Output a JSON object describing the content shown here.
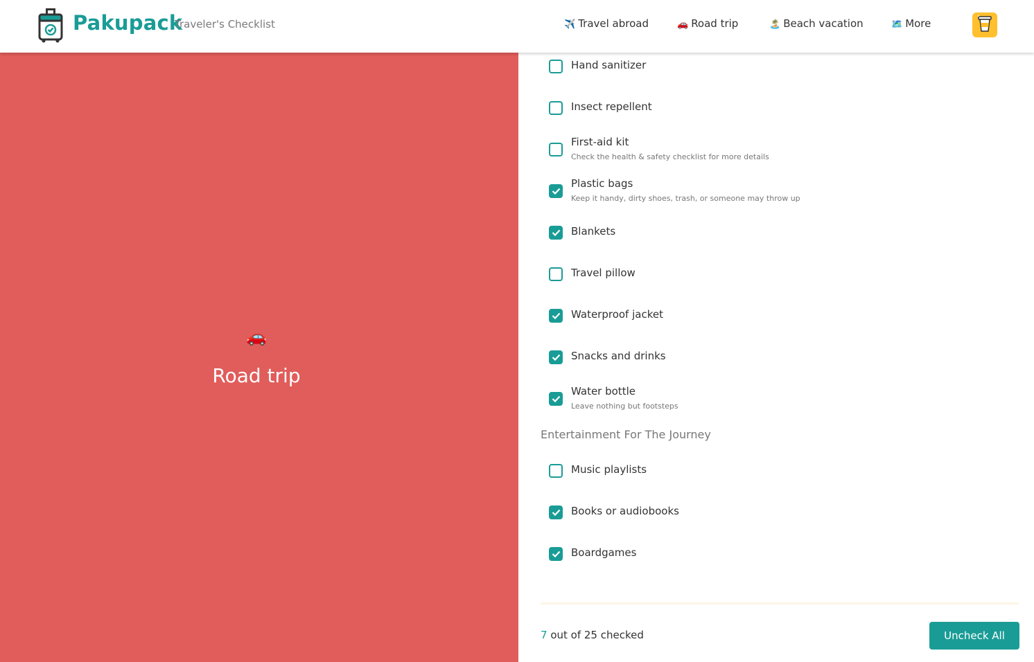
{
  "header": {
    "brand": "Pakupack",
    "tagline": "Traveler's Checklist",
    "nav": [
      {
        "emoji": "✈️",
        "label": "Travel abroad"
      },
      {
        "emoji": "🚗",
        "label": "Road trip"
      },
      {
        "emoji": "🏝️",
        "label": "Beach vacation"
      },
      {
        "emoji": "🗺️",
        "label": "More"
      }
    ]
  },
  "hero": {
    "emoji": "🚗",
    "title": "Road trip",
    "background": "#e05d5b"
  },
  "checklist": {
    "items": [
      {
        "label": "Hand sanitizer",
        "note": "",
        "checked": false
      },
      {
        "label": "Insect repellent",
        "note": "",
        "checked": false
      },
      {
        "label": "First-aid kit",
        "note": "Check the health & safety checklist for more details",
        "checked": false
      },
      {
        "label": "Plastic bags",
        "note": "Keep it handy, dirty shoes, trash, or someone may throw up",
        "checked": true
      },
      {
        "label": "Blankets",
        "note": "",
        "checked": true
      },
      {
        "label": "Travel pillow",
        "note": "",
        "checked": false
      },
      {
        "label": "Waterproof jacket",
        "note": "",
        "checked": true
      },
      {
        "label": "Snacks and drinks",
        "note": "",
        "checked": true
      },
      {
        "label": "Water bottle",
        "note": "Leave nothing but footsteps",
        "checked": true
      }
    ],
    "section_title": "Entertainment For The Journey",
    "section_items": [
      {
        "label": "Music playlists",
        "note": "",
        "checked": false
      },
      {
        "label": "Books or audiobooks",
        "note": "",
        "checked": true
      },
      {
        "label": "Boardgames",
        "note": "",
        "checked": true
      }
    ]
  },
  "footer": {
    "checked_count": "7",
    "counter_text": " out of 25 checked",
    "uncheck_label": "Uncheck All"
  },
  "colors": {
    "accent": "#1a9c96",
    "hero": "#e05d5b",
    "coffee": "#ffbf2e"
  },
  "icons": {
    "logo": "suitcase-check-icon",
    "coffee": "coffee-cup-icon",
    "checkmark": "check-icon"
  }
}
